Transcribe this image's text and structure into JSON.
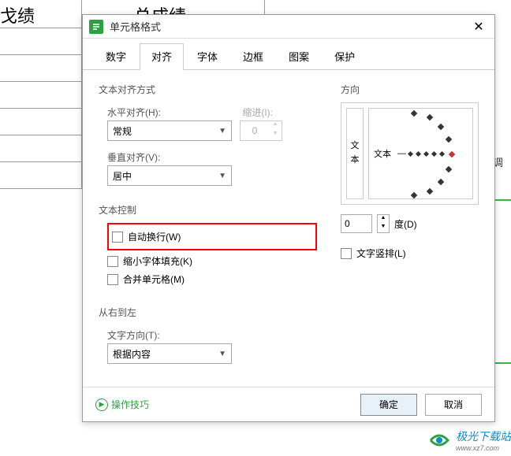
{
  "bg": {
    "col1": "戈绩",
    "col2": "总成绩",
    "side_text": "单元格自动调"
  },
  "dialog": {
    "title": "单元格格式",
    "tabs": [
      "数字",
      "对齐",
      "字体",
      "边框",
      "图案",
      "保护"
    ],
    "active_tab_index": 1,
    "groups": {
      "text_align": "文本对齐方式",
      "text_control": "文本控制",
      "rtl": "从右到左",
      "direction": "方向"
    },
    "h_align": {
      "label": "水平对齐(H):",
      "value": "常规"
    },
    "indent": {
      "label": "缩进(I):",
      "value": "0"
    },
    "v_align": {
      "label": "垂直对齐(V):",
      "value": "居中"
    },
    "controls": {
      "wrap": "自动换行(W)",
      "shrink": "缩小字体填充(K)",
      "merge": "合并单元格(M)"
    },
    "text_dir": {
      "label": "文字方向(T):",
      "value": "根据内容"
    },
    "orientation": {
      "v_label_1": "文",
      "v_label_2": "本",
      "radial_label": "文本",
      "degree_value": "0",
      "degree_label": "度(D)",
      "vertical_check": "文字竖排(L)"
    },
    "footer": {
      "tips": "操作技巧",
      "ok": "确定",
      "cancel": "取消"
    }
  },
  "watermark": {
    "name": "极光下载站",
    "url": "www.xz7.com"
  }
}
